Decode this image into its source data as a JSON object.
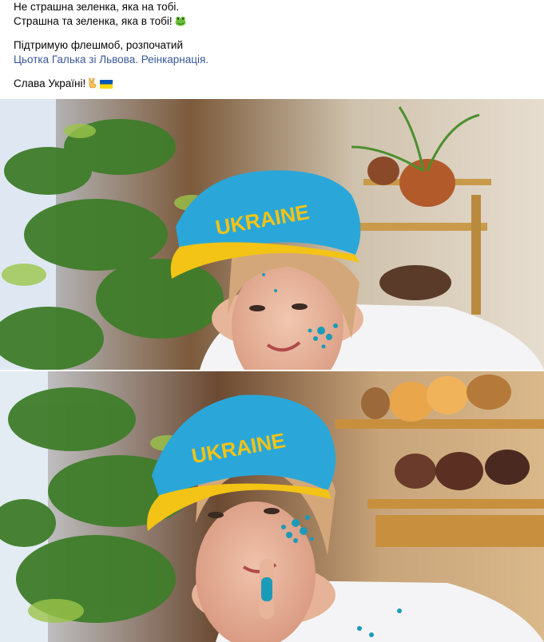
{
  "post": {
    "lines": [
      "Не страшна зеленка, яка на тобі.",
      "Страшна та зеленка, яка в тобі!"
    ],
    "support_prefix": "Підтримую флешмоб, розпочатий",
    "mention_link": "Цьотка Галька зі Львова. Реінкарнація.",
    "closing": "Слава Україні!"
  },
  "icons": {
    "emoji_1": "frog-face-icon",
    "emoji_2": "victory-hand-icon",
    "emoji_3": "ukraine-flag-icon"
  },
  "photos": {
    "cap_text": "UKRAINE",
    "count": 2
  },
  "colors": {
    "link": "#385898",
    "cap_blue": "#2aa7d8",
    "cap_yellow": "#f3c316",
    "paint": "#1b9bb8"
  }
}
